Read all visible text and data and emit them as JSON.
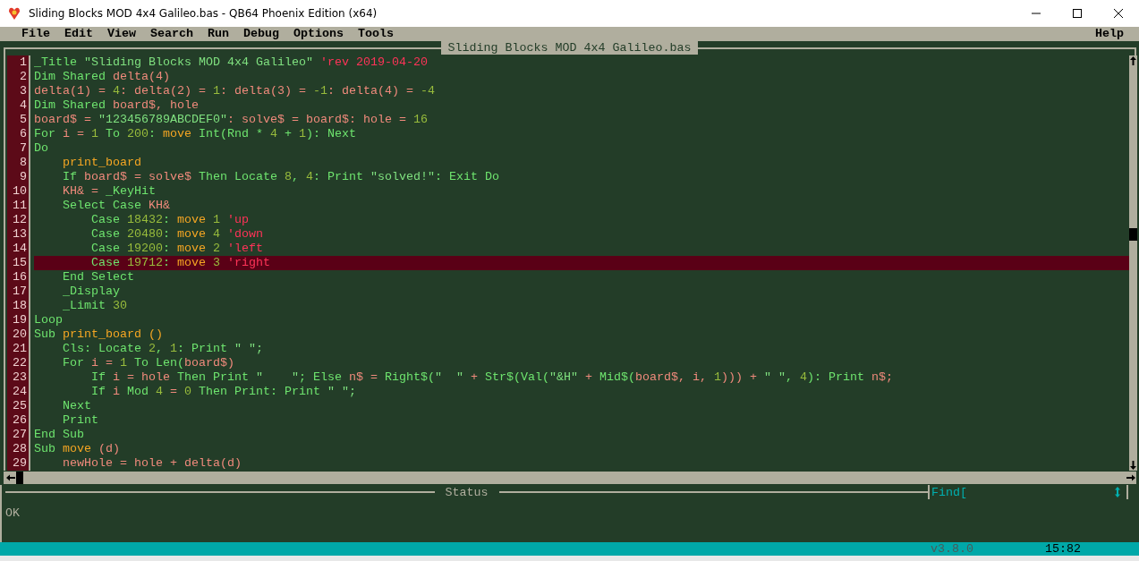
{
  "window": {
    "title": "Sliding Blocks MOD 4x4 Galileo.bas - QB64 Phoenix Edition (x64)"
  },
  "menu": {
    "items": [
      "File",
      "Edit",
      "View",
      "Search",
      "Run",
      "Debug",
      "Options",
      "Tools"
    ],
    "help": "Help"
  },
  "editor": {
    "title": "Sliding Blocks MOD 4x4 Galileo.bas",
    "lines": [
      {
        "number": "1",
        "selected": false,
        "tokens": [
          {
            "text": "_Title ",
            "kind": "keyword"
          },
          {
            "text": "\"Sliding Blocks MOD 4x4 Galileo\" ",
            "kind": "string"
          },
          {
            "text": "'rev 2019-04-20",
            "kind": "comment"
          }
        ]
      },
      {
        "number": "2",
        "selected": false,
        "tokens": [
          {
            "text": "Dim Shared ",
            "kind": "keyword"
          },
          {
            "text": "delta(4)",
            "kind": "variable"
          }
        ]
      },
      {
        "number": "3",
        "selected": false,
        "tokens": [
          {
            "text": "delta(1) = ",
            "kind": "variable"
          },
          {
            "text": "4",
            "kind": "number"
          },
          {
            "text": ": delta(2) = ",
            "kind": "variable"
          },
          {
            "text": "1",
            "kind": "number"
          },
          {
            "text": ": delta(3) = ",
            "kind": "variable"
          },
          {
            "text": "-1",
            "kind": "number"
          },
          {
            "text": ": delta(4) = ",
            "kind": "variable"
          },
          {
            "text": "-4",
            "kind": "number"
          }
        ]
      },
      {
        "number": "4",
        "selected": false,
        "tokens": [
          {
            "text": "Dim Shared ",
            "kind": "keyword"
          },
          {
            "text": "board$, hole",
            "kind": "variable"
          }
        ]
      },
      {
        "number": "5",
        "selected": false,
        "tokens": [
          {
            "text": "board$ = ",
            "kind": "variable"
          },
          {
            "text": "\"123456789ABCDEF0\"",
            "kind": "string"
          },
          {
            "text": ": solve$ = board$: hole = ",
            "kind": "variable"
          },
          {
            "text": "16",
            "kind": "number"
          }
        ]
      },
      {
        "number": "6",
        "selected": false,
        "tokens": [
          {
            "text": "For ",
            "kind": "keyword"
          },
          {
            "text": "i = ",
            "kind": "variable"
          },
          {
            "text": "1",
            "kind": "number"
          },
          {
            "text": " To ",
            "kind": "keyword"
          },
          {
            "text": "200",
            "kind": "number"
          },
          {
            "text": ": ",
            "kind": "keyword"
          },
          {
            "text": "move ",
            "kind": "sub"
          },
          {
            "text": "Int(Rnd * ",
            "kind": "keyword"
          },
          {
            "text": "4",
            "kind": "number"
          },
          {
            "text": " + ",
            "kind": "keyword"
          },
          {
            "text": "1",
            "kind": "number"
          },
          {
            "text": "): Next",
            "kind": "keyword"
          }
        ]
      },
      {
        "number": "7",
        "selected": false,
        "tokens": [
          {
            "text": "Do",
            "kind": "keyword"
          }
        ]
      },
      {
        "number": "8",
        "selected": false,
        "tokens": [
          {
            "text": "    print_board",
            "kind": "sub"
          }
        ]
      },
      {
        "number": "9",
        "selected": false,
        "tokens": [
          {
            "text": "    If ",
            "kind": "keyword"
          },
          {
            "text": "board$ = solve$ ",
            "kind": "variable"
          },
          {
            "text": "Then Locate ",
            "kind": "keyword"
          },
          {
            "text": "8",
            "kind": "number"
          },
          {
            "text": ", ",
            "kind": "keyword"
          },
          {
            "text": "4",
            "kind": "number"
          },
          {
            "text": ": Print ",
            "kind": "keyword"
          },
          {
            "text": "\"solved!\"",
            "kind": "string"
          },
          {
            "text": ": Exit Do",
            "kind": "keyword"
          }
        ]
      },
      {
        "number": "10",
        "selected": false,
        "tokens": [
          {
            "text": "    KH& = ",
            "kind": "variable"
          },
          {
            "text": "_KeyHit",
            "kind": "keyword"
          }
        ]
      },
      {
        "number": "11",
        "selected": false,
        "tokens": [
          {
            "text": "    Select Case ",
            "kind": "keyword"
          },
          {
            "text": "KH&",
            "kind": "variable"
          }
        ]
      },
      {
        "number": "12",
        "selected": false,
        "tokens": [
          {
            "text": "        Case ",
            "kind": "keyword"
          },
          {
            "text": "18432",
            "kind": "number"
          },
          {
            "text": ": ",
            "kind": "keyword"
          },
          {
            "text": "move ",
            "kind": "sub"
          },
          {
            "text": "1 ",
            "kind": "number"
          },
          {
            "text": "'up",
            "kind": "comment"
          }
        ]
      },
      {
        "number": "13",
        "selected": false,
        "tokens": [
          {
            "text": "        Case ",
            "kind": "keyword"
          },
          {
            "text": "20480",
            "kind": "number"
          },
          {
            "text": ": ",
            "kind": "keyword"
          },
          {
            "text": "move ",
            "kind": "sub"
          },
          {
            "text": "4 ",
            "kind": "number"
          },
          {
            "text": "'down",
            "kind": "comment"
          }
        ]
      },
      {
        "number": "14",
        "selected": false,
        "tokens": [
          {
            "text": "        Case ",
            "kind": "keyword"
          },
          {
            "text": "19200",
            "kind": "number"
          },
          {
            "text": ": ",
            "kind": "keyword"
          },
          {
            "text": "move ",
            "kind": "sub"
          },
          {
            "text": "2 ",
            "kind": "number"
          },
          {
            "text": "'left",
            "kind": "comment"
          }
        ]
      },
      {
        "number": "15",
        "selected": true,
        "tokens": [
          {
            "text": "        Case ",
            "kind": "keyword"
          },
          {
            "text": "19712",
            "kind": "number"
          },
          {
            "text": ": ",
            "kind": "keyword"
          },
          {
            "text": "move ",
            "kind": "sub"
          },
          {
            "text": "3 ",
            "kind": "number"
          },
          {
            "text": "'right",
            "kind": "comment"
          }
        ]
      },
      {
        "number": "16",
        "selected": false,
        "tokens": [
          {
            "text": "    End Select",
            "kind": "keyword"
          }
        ]
      },
      {
        "number": "17",
        "selected": false,
        "tokens": [
          {
            "text": "    _Display",
            "kind": "keyword"
          }
        ]
      },
      {
        "number": "18",
        "selected": false,
        "tokens": [
          {
            "text": "    _Limit ",
            "kind": "keyword"
          },
          {
            "text": "30",
            "kind": "number"
          }
        ]
      },
      {
        "number": "19",
        "selected": false,
        "tokens": [
          {
            "text": "Loop",
            "kind": "keyword"
          }
        ]
      },
      {
        "number": "20",
        "selected": false,
        "tokens": [
          {
            "text": "Sub ",
            "kind": "keyword"
          },
          {
            "text": "print_board ()",
            "kind": "sub"
          }
        ]
      },
      {
        "number": "21",
        "selected": false,
        "tokens": [
          {
            "text": "    Cls: Locate ",
            "kind": "keyword"
          },
          {
            "text": "2",
            "kind": "number"
          },
          {
            "text": ", ",
            "kind": "keyword"
          },
          {
            "text": "1",
            "kind": "number"
          },
          {
            "text": ": Print ",
            "kind": "keyword"
          },
          {
            "text": "\" \";",
            "kind": "string"
          }
        ]
      },
      {
        "number": "22",
        "selected": false,
        "tokens": [
          {
            "text": "    For ",
            "kind": "keyword"
          },
          {
            "text": "i = ",
            "kind": "variable"
          },
          {
            "text": "1",
            "kind": "number"
          },
          {
            "text": " To Len(",
            "kind": "keyword"
          },
          {
            "text": "board$)",
            "kind": "variable"
          }
        ]
      },
      {
        "number": "23",
        "selected": false,
        "tokens": [
          {
            "text": "        If ",
            "kind": "keyword"
          },
          {
            "text": "i = hole ",
            "kind": "variable"
          },
          {
            "text": "Then Print ",
            "kind": "keyword"
          },
          {
            "text": "\"    \"",
            "kind": "string"
          },
          {
            "text": "; Else ",
            "kind": "keyword"
          },
          {
            "text": "n$ = ",
            "kind": "variable"
          },
          {
            "text": "Right$(",
            "kind": "keyword"
          },
          {
            "text": "\"  \"",
            "kind": "string"
          },
          {
            "text": " + ",
            "kind": "variable"
          },
          {
            "text": "Str$(Val(",
            "kind": "keyword"
          },
          {
            "text": "\"&H\"",
            "kind": "string"
          },
          {
            "text": " + ",
            "kind": "variable"
          },
          {
            "text": "Mid$(",
            "kind": "keyword"
          },
          {
            "text": "board$, i, ",
            "kind": "variable"
          },
          {
            "text": "1",
            "kind": "number"
          },
          {
            "text": "))) + ",
            "kind": "variable"
          },
          {
            "text": "\" \"",
            "kind": "string"
          },
          {
            "text": ", ",
            "kind": "keyword"
          },
          {
            "text": "4",
            "kind": "number"
          },
          {
            "text": "): Print ",
            "kind": "keyword"
          },
          {
            "text": "n$;",
            "kind": "variable"
          }
        ]
      },
      {
        "number": "24",
        "selected": false,
        "tokens": [
          {
            "text": "        If ",
            "kind": "keyword"
          },
          {
            "text": "i ",
            "kind": "variable"
          },
          {
            "text": "Mod ",
            "kind": "keyword"
          },
          {
            "text": "4",
            "kind": "number"
          },
          {
            "text": " = ",
            "kind": "variable"
          },
          {
            "text": "0",
            "kind": "number"
          },
          {
            "text": " Then Print: Print ",
            "kind": "keyword"
          },
          {
            "text": "\" \";",
            "kind": "string"
          }
        ]
      },
      {
        "number": "25",
        "selected": false,
        "tokens": [
          {
            "text": "    Next",
            "kind": "keyword"
          }
        ]
      },
      {
        "number": "26",
        "selected": false,
        "tokens": [
          {
            "text": "    Print",
            "kind": "keyword"
          }
        ]
      },
      {
        "number": "27",
        "selected": false,
        "tokens": [
          {
            "text": "End Sub",
            "kind": "keyword"
          }
        ]
      },
      {
        "number": "28",
        "selected": false,
        "tokens": [
          {
            "text": "Sub ",
            "kind": "keyword"
          },
          {
            "text": "move ",
            "kind": "sub"
          },
          {
            "text": "(d)",
            "kind": "variable"
          }
        ]
      },
      {
        "number": "29",
        "selected": false,
        "tokens": [
          {
            "text": "    newHole = hole + delta(d)",
            "kind": "variable"
          }
        ]
      }
    ]
  },
  "status": {
    "title": "Status",
    "find_label": "Find[",
    "output": "OK"
  },
  "status_bar": {
    "version": "v3.8.0",
    "position": "15:82"
  }
}
